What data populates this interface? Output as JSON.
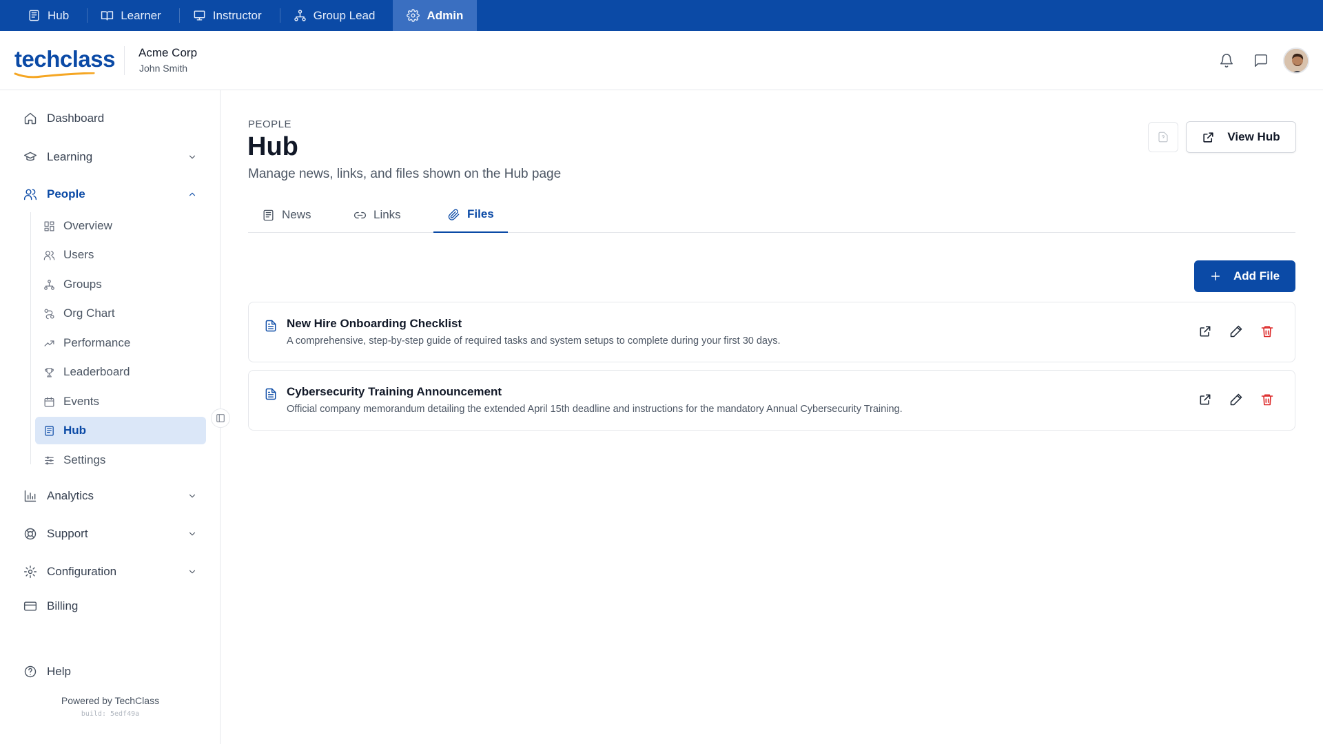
{
  "roles": {
    "hub": "Hub",
    "learner": "Learner",
    "instructor": "Instructor",
    "group_lead": "Group Lead",
    "admin": "Admin",
    "active": "Admin"
  },
  "header": {
    "logo": "techclass",
    "org_name": "Acme Corp",
    "user_name": "John Smith",
    "icons": [
      "bell-icon",
      "message-icon",
      "avatar"
    ]
  },
  "sidebar": {
    "dashboard": "Dashboard",
    "learning": "Learning",
    "people": "People",
    "people_items": {
      "overview": "Overview",
      "users": "Users",
      "groups": "Groups",
      "org_chart": "Org Chart",
      "performance": "Performance",
      "leaderboard": "Leaderboard",
      "events": "Events",
      "hub": "Hub",
      "settings": "Settings"
    },
    "analytics": "Analytics",
    "support": "Support",
    "configuration": "Configuration",
    "billing": "Billing",
    "help": "Help",
    "powered_by": "Powered by TechClass",
    "build": "build: 5edf49a"
  },
  "page": {
    "breadcrumb": "PEOPLE",
    "title": "Hub",
    "description": "Manage news, links, and files shown on the Hub page",
    "view_hub_label": "View Hub"
  },
  "tabs": {
    "news": "News",
    "links": "Links",
    "files": "Files",
    "active": "Files"
  },
  "files": {
    "add_label": "Add File",
    "items": [
      {
        "title": "New Hire Onboarding Checklist",
        "description": "A comprehensive, step-by-step guide of required tasks and system setups to complete during your first 30 days."
      },
      {
        "title": "Cybersecurity Training Announcement",
        "description": "Official company memorandum detailing the extended April 15th deadline and instructions for the mandatory Annual Cybersecurity Training."
      }
    ]
  },
  "colors": {
    "brand": "#0b4aa6",
    "active_role_bg": "#3a6fc1",
    "active_nav_bg": "#dbe7f8",
    "delete": "#dc2626",
    "logo_accent": "#f5a623"
  }
}
